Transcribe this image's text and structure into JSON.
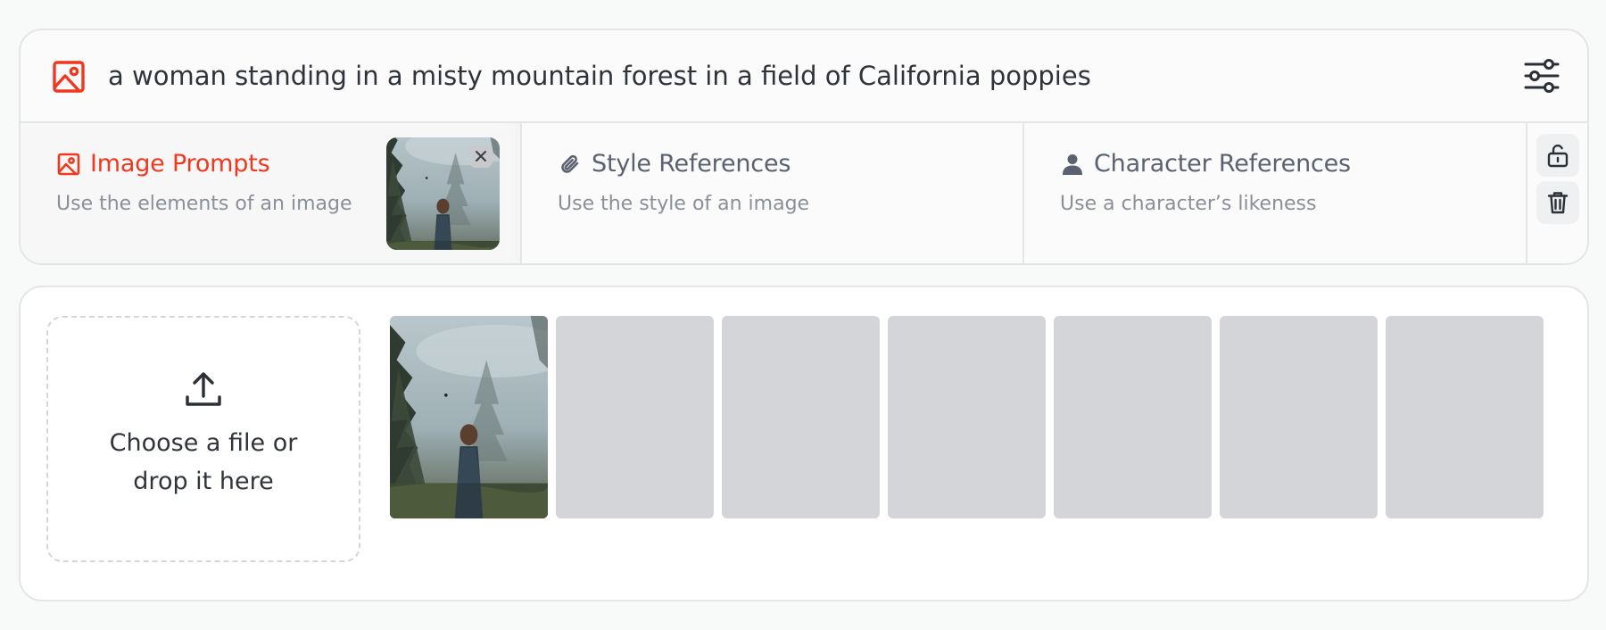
{
  "prompt": {
    "text": "a woman standing in a misty mountain forest in a field of California poppies"
  },
  "reference_tabs": [
    {
      "title": "Image Prompts",
      "subtitle": "Use the elements of an image",
      "icon": "image-icon",
      "active": true
    },
    {
      "title": "Style References",
      "subtitle": "Use the style of an image",
      "icon": "paperclip-icon",
      "active": false
    },
    {
      "title": "Character References",
      "subtitle": "Use a character’s likeness",
      "icon": "person-icon",
      "active": false
    }
  ],
  "upload": {
    "label": "Choose a file or drop it here",
    "icon": "upload-icon"
  },
  "image_grid": {
    "filled": 1,
    "empty_slots": 6
  },
  "colors": {
    "accent": "#f0381e",
    "placeholder": "#d4d5d8"
  },
  "icons": [
    "image-icon",
    "sliders-icon",
    "paperclip-icon",
    "person-icon",
    "unlock-icon",
    "trash-icon",
    "close-icon",
    "upload-icon"
  ]
}
